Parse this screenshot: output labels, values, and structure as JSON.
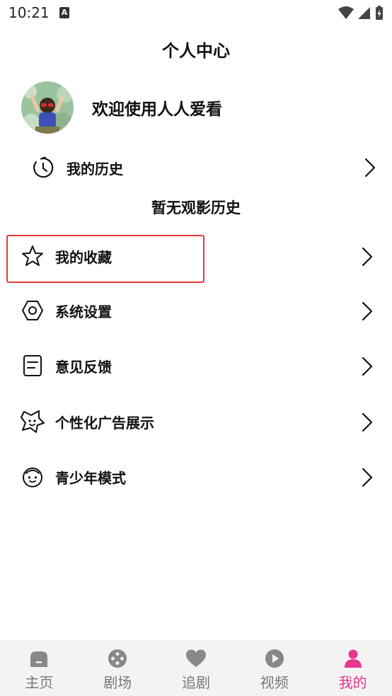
{
  "status_bar": {
    "time": "10:21",
    "notif_letter": "A"
  },
  "header": {
    "title": "个人中心"
  },
  "profile": {
    "welcome": "欢迎使用人人爱看"
  },
  "history": {
    "label": "我的历史",
    "empty_text": "暂无观影历史"
  },
  "menu": [
    {
      "label": "我的收藏",
      "icon": "star-icon"
    },
    {
      "label": "系统设置",
      "icon": "settings-hexagon-icon"
    },
    {
      "label": "意见反馈",
      "icon": "feedback-note-icon"
    },
    {
      "label": "个性化广告展示",
      "icon": "sparkle-badge-icon"
    },
    {
      "label": "青少年模式",
      "icon": "child-face-icon"
    }
  ],
  "tabs": [
    {
      "label": "主页",
      "icon": "home-icon"
    },
    {
      "label": "剧场",
      "icon": "theater-icon"
    },
    {
      "label": "追剧",
      "icon": "heart-icon"
    },
    {
      "label": "视频",
      "icon": "play-icon"
    },
    {
      "label": "我的",
      "icon": "person-icon",
      "active": true
    }
  ],
  "colors": {
    "accent": "#e8368f",
    "highlight_border": "#e53935",
    "tabbar_bg": "#f3f3f3"
  }
}
